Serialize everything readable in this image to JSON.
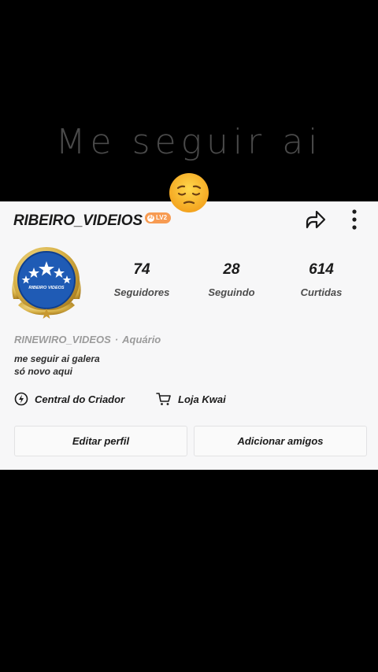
{
  "overlay": {
    "caption": "Me seguir ai",
    "emoji": "😔"
  },
  "profile": {
    "username": "RIBEIRO_VIDEIOS",
    "level_badge": "LV2",
    "level_badge_prefix": "Ai",
    "avatar_label": "RIBEIRO VIDEOS",
    "stats": [
      {
        "value": "74",
        "label": "Seguidores"
      },
      {
        "value": "28",
        "label": "Seguindo"
      },
      {
        "value": "614",
        "label": "Curtidas"
      }
    ],
    "handle": "RINEWIRO_VIDEOS",
    "separator": "·",
    "sign": "Aquário",
    "bio_lines": [
      "me seguir ai galera",
      "só novo aqui"
    ],
    "links": {
      "creator_center": "Central do Criador",
      "kwai_store": "Loja Kwai"
    },
    "buttons": {
      "edit": "Editar perfil",
      "add_friends": "Adicionar amigos"
    }
  },
  "colors": {
    "background": "#000000",
    "card": "#f7f7f8",
    "badge": "#f79b52",
    "avatar_blue": "#1f5bb5",
    "avatar_gold": "#d8b248"
  },
  "icons": [
    "share-icon",
    "more-vertical-icon",
    "lightning-icon",
    "cart-icon",
    "sad-face-emoji"
  ]
}
